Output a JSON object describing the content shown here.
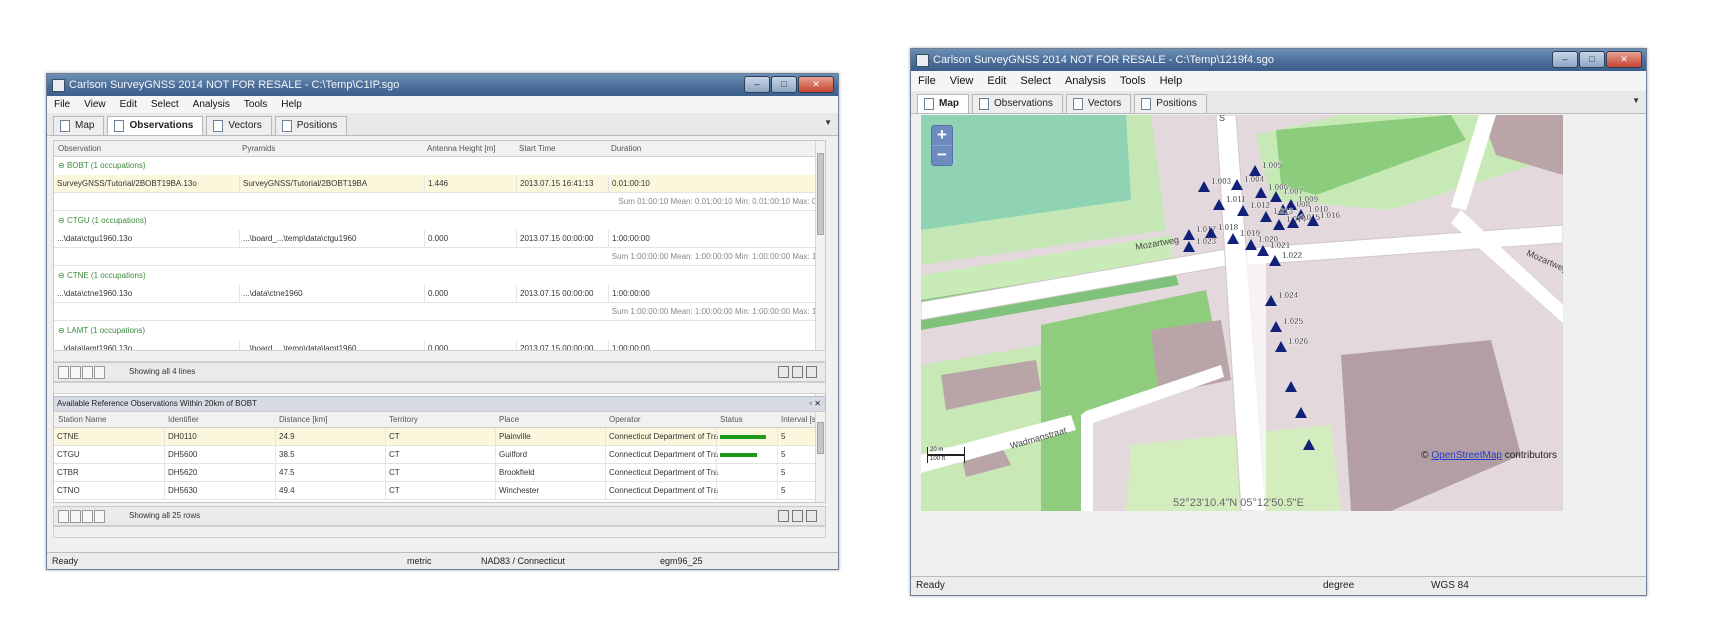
{
  "left_window": {
    "title": "Carlson SurveyGNSS 2014  NOT FOR RESALE - C:\\Temp\\C1IP.sgo",
    "menus": [
      "File",
      "View",
      "Edit",
      "Select",
      "Analysis",
      "Tools",
      "Help"
    ],
    "tabs": [
      "Map",
      "Observations",
      "Vectors",
      "Positions"
    ],
    "active_tab": "Observations",
    "obs_columns": [
      "Observation",
      "Pyramids",
      "Antenna Height [m]",
      "Start Time",
      "Duration"
    ],
    "obs_groups": [
      {
        "label": "BOBT (1 occupations)",
        "row": [
          "SurveyGNSS/Tutorial/2BOBT19BA.13o",
          "SurveyGNSS/Tutorial/2BOBT19BA",
          "1.446",
          "2013.07.15 16:41:13",
          "0.01:00:10"
        ],
        "summary": "Sum 01:00:10 Mean: 0.01:00:10 Min: 0.01:00:10 Max: 0.0"
      },
      {
        "label": "CTGU (1 occupations)",
        "row": [
          "...\\data\\ctgu1960.13o",
          "...\\board_...\\temp\\data\\ctgu1960",
          "0.000",
          "2013.07.15 00:00:00",
          "1:00:00:00"
        ],
        "summary": "Sum 1:00:00:00 Mean: 1:00:00:00 Min: 1:00:00:00 Max: 1:0"
      },
      {
        "label": "CTNE (1 occupations)",
        "row": [
          "...\\data\\ctne1960.13o",
          "...\\data\\ctne1960",
          "0.000",
          "2013.07.15 00:00:00",
          "1:00:00:00"
        ],
        "summary": "Sum 1:00:00:00 Mean: 1:00:00:00 Min: 1:00:00:00 Max: 1:0"
      },
      {
        "label": "LAMT (1 occupations)",
        "row": [
          "...\\data\\lamt1960.13o",
          "...\\board_...\\temp\\data\\lamt1960",
          "0.000",
          "2013.07.15 00:00:00",
          "1:00:00:00"
        ],
        "summary": ""
      }
    ],
    "obs_pager_text": "Showing all 4 lines",
    "ref_panel_title": "Available Reference Observations Within 20km of BOBT",
    "ref_columns": [
      "Station Name",
      "Identifier",
      "Distance [km]",
      "Territory",
      "Place",
      "Operator",
      "Status",
      "Interval [s]"
    ],
    "ref_rows": [
      [
        "CTNE",
        "DH0110",
        "24.9",
        "CT",
        "Plainville",
        "Connecticut Department of Tra",
        "",
        "5"
      ],
      [
        "CTGU",
        "DH5600",
        "38.5",
        "CT",
        "Guilford",
        "Connecticut Department of Tra",
        "",
        "5"
      ],
      [
        "CTBR",
        "DH5620",
        "47.5",
        "CT",
        "Brookfield",
        "Connecticut Department of Tra",
        "",
        "5"
      ],
      [
        "CTNO",
        "DH5630",
        "49.4",
        "CT",
        "Winchester",
        "Connecticut Department of Tra",
        "",
        "5"
      ]
    ],
    "ref_status_bars": [
      1,
      0.8,
      0,
      0
    ],
    "ref_pager_text": "Showing all 25 rows",
    "status": [
      "Ready",
      "metric",
      "NAD83 / Connecticut",
      "egm96_25"
    ]
  },
  "right_window": {
    "title": "Carlson SurveyGNSS 2014  NOT FOR RESALE - C:\\Temp\\1219f4.sgo",
    "menus": [
      "File",
      "View",
      "Edit",
      "Select",
      "Analysis",
      "Tools",
      "Help"
    ],
    "tabs": [
      "Map",
      "Observations",
      "Vectors",
      "Positions"
    ],
    "active_tab": "Map",
    "map": {
      "zoom_in": "+",
      "zoom_out": "−",
      "attribution_prefix": "©",
      "attribution_link": "OpenStreetMap",
      "attribution_suffix": "contributors",
      "coordinates": "52°23'10.4\"N 05°12'50.5\"E",
      "scale_labels": [
        "20 m",
        "100 ft"
      ],
      "street_labels": [
        "Mozartweg",
        "Wadmanstraat",
        "Mozartweg",
        "S"
      ],
      "point_labels": [
        "1.003",
        "1.004",
        "1.005",
        "1.006",
        "1.007",
        "1.008",
        "1.009",
        "1.010",
        "1.011",
        "1.012",
        "1.013",
        "1.014",
        "1.015",
        "1.016",
        "1.017",
        "1.018",
        "1.019",
        "1.020",
        "1.021",
        "1.022",
        "1.023",
        "1.024",
        "1.025",
        "1.026"
      ],
      "marker_color": "#12207a"
    },
    "status": [
      "Ready",
      "degree",
      "WGS 84"
    ]
  }
}
